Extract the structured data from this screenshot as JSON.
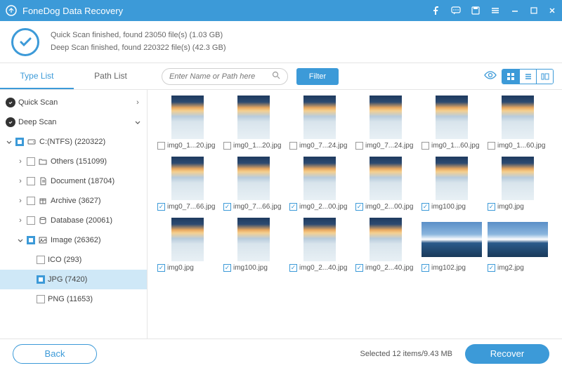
{
  "app": {
    "title": "FoneDog Data Recovery"
  },
  "banner": {
    "line1": "Quick Scan finished, found 23050 file(s) (1.03 GB)",
    "line2": "Deep Scan finished, found 220322 file(s) (42.3 GB)"
  },
  "tabs": {
    "type_list": "Type List",
    "path_list": "Path List"
  },
  "search": {
    "placeholder": "Enter Name or Path here"
  },
  "filter": {
    "label": "Filter"
  },
  "tree": {
    "quick_scan": "Quick Scan",
    "deep_scan": "Deep Scan",
    "drive": "C:(NTFS) (220322)",
    "others": "Others (151099)",
    "document": "Document (18704)",
    "archive": "Archive (3627)",
    "database": "Database (20061)",
    "image": "Image (26362)",
    "ico": "ICO (293)",
    "jpg": "JPG (7420)",
    "png": "PNG (11653)"
  },
  "files": [
    {
      "name": "img0_1...20.jpg",
      "checked": false,
      "style": "a"
    },
    {
      "name": "img0_1...20.jpg",
      "checked": false,
      "style": "a"
    },
    {
      "name": "img0_7...24.jpg",
      "checked": false,
      "style": "a"
    },
    {
      "name": "img0_7...24.jpg",
      "checked": false,
      "style": "a"
    },
    {
      "name": "img0_1...60.jpg",
      "checked": false,
      "style": "a"
    },
    {
      "name": "img0_1...60.jpg",
      "checked": false,
      "style": "a"
    },
    {
      "name": "img0_7...66.jpg",
      "checked": true,
      "style": "a"
    },
    {
      "name": "img0_7...66.jpg",
      "checked": true,
      "style": "a"
    },
    {
      "name": "img0_2...00.jpg",
      "checked": true,
      "style": "a"
    },
    {
      "name": "img0_2...00.jpg",
      "checked": true,
      "style": "a"
    },
    {
      "name": "img100.jpg",
      "checked": true,
      "style": "a"
    },
    {
      "name": "img0.jpg",
      "checked": true,
      "style": "a"
    },
    {
      "name": "img0.jpg",
      "checked": true,
      "style": "a"
    },
    {
      "name": "img100.jpg",
      "checked": true,
      "style": "a"
    },
    {
      "name": "img0_2...40.jpg",
      "checked": true,
      "style": "a"
    },
    {
      "name": "img0_2...40.jpg",
      "checked": true,
      "style": "a"
    },
    {
      "name": "img102.jpg",
      "checked": true,
      "style": "b"
    },
    {
      "name": "img2.jpg",
      "checked": true,
      "style": "b"
    }
  ],
  "footer": {
    "back": "Back",
    "status": "Selected 12 items/9.43 MB",
    "recover": "Recover"
  }
}
